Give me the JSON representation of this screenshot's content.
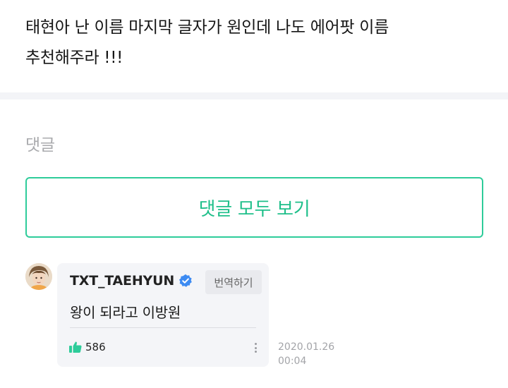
{
  "post": {
    "line1": "태현아 난 이름 마지막 글자가 원인데 나도 에어팟 이름",
    "line2": "추천해주라 !!!"
  },
  "comments_section": {
    "title": "댓글",
    "view_all_label": "댓글 모두 보기",
    "accent_color": "#2ecc9a"
  },
  "reply": {
    "author": "TXT_TAEHYUN",
    "verified_icon": "verified-badge-icon",
    "translate_label": "번역하기",
    "body": "왕이 되라고 이방원",
    "like_icon": "thumbs-up-icon",
    "like_count": "586",
    "date": "2020.01.26",
    "time": "00:04"
  }
}
